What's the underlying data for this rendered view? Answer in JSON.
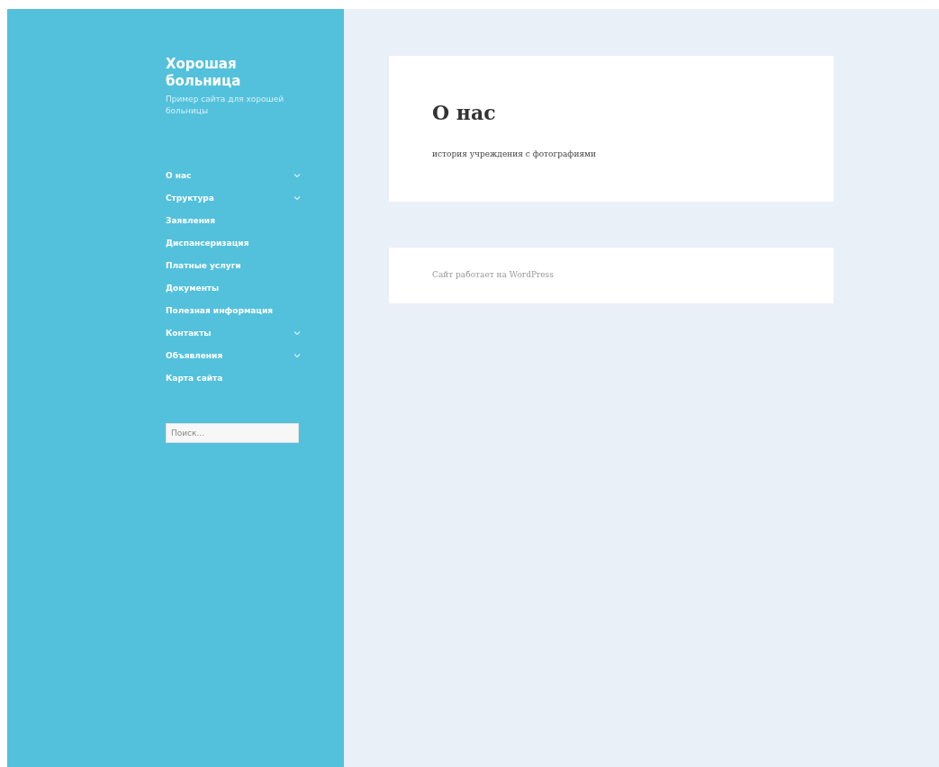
{
  "site": {
    "title": "Хорошая больница",
    "tagline": "Пример сайта для хорошей больницы"
  },
  "menu": [
    {
      "label": "О нас",
      "has_submenu": true
    },
    {
      "label": "Структура",
      "has_submenu": true
    },
    {
      "label": "Заявления",
      "has_submenu": false
    },
    {
      "label": "Диспансеризация",
      "has_submenu": false
    },
    {
      "label": "Платные услуги",
      "has_submenu": false
    },
    {
      "label": "Документы",
      "has_submenu": false
    },
    {
      "label": "Полезная информация",
      "has_submenu": false
    },
    {
      "label": "Контакты",
      "has_submenu": true
    },
    {
      "label": "Объявления",
      "has_submenu": true
    },
    {
      "label": "Карта сайта",
      "has_submenu": false
    }
  ],
  "search": {
    "placeholder": "Поиск..."
  },
  "page": {
    "title": "О нас",
    "text": "история учреждения с фотографиями"
  },
  "footer": {
    "text": "Сайт работает на WordPress"
  }
}
